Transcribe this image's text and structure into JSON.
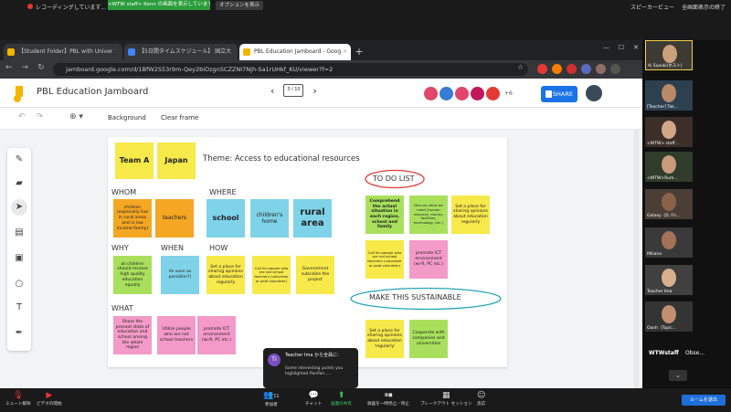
{
  "zoom_top": {
    "recording_label": "レコーディングしています...",
    "banner": "<WTW staff> Kenn の画面を表示しています",
    "options": "オプションを表示",
    "speaker_view": "スピーカービュー",
    "exit_fullscreen": "全画面表示の終了"
  },
  "browser": {
    "tabs": [
      {
        "label": "【Student Folder】PBL with Univer",
        "color": "#f4b400"
      },
      {
        "label": "【5日間タイムスケジュール】 国立大",
        "color": "#4285f4"
      },
      {
        "label": "PBL Education Jamboard - Goog",
        "color": "#f4b400"
      }
    ],
    "url": "jamboard.google.com/d/1BfW2S53r9m-Qey2biOzgnSCZZNI7Njh-Sa1rUHkf_KU/viewer?f=2"
  },
  "jamboard": {
    "title": "PBL Education Jamboard",
    "page_indicator": "3 / 10",
    "extra_collaborators": "+6",
    "share_label": "SHARE",
    "background_label": "Background",
    "clear_label": "Clear frame",
    "collab_colors": [
      "#e0476a",
      "#3a7bd5",
      "#e0476a",
      "#c2185b",
      "#e53935"
    ]
  },
  "board": {
    "team_a": "Team A",
    "japan": "Japan",
    "theme": "Theme: Access to educational resources",
    "whom_label": "WHOM",
    "where_label": "WHERE",
    "why_label": "WHY",
    "when_label": "WHEN",
    "how_label": "HOW",
    "what_label": "WHAT",
    "todo_label": "TO DO LIST",
    "sustain_label": "MAKE THIS SUSTAINABLE",
    "notes": {
      "whom1": "children (especially live in rural areas and in low income family)",
      "whom2": "teachers",
      "where1": "school",
      "where2": "children's home",
      "where3": "rural area",
      "why1": "all children should receive high quality education equally",
      "when1": "As soon as possible(?)",
      "how1": "Set a place for sharing opinions about education regularly",
      "how2": "Call for people who are not school teachers (volunteer or paid volunteer)",
      "how3": "Government subsidize the project",
      "what1": "Share the present state of education and school among the whole region",
      "what2": "Utilize people who are not school teachers",
      "what3": "promote ICT environment (wi-fi, PC etc.)",
      "todo1": "Comprehend the actual situation in each region, school and family",
      "todo2": "Discuss what we need (human resource, money, facilities, technology, etc.)",
      "todo3": "Set a place for sharing opinions about education regularly",
      "todo4": "Call for people who are not school teachers (volunteer or paid volunteer)",
      "todo5": "promote ICT environment (wi-fi, PC etc.)",
      "sus1": "Set a place for sharing opinions about education 'regularly'",
      "sus2": "Cooperate with companies and universities"
    }
  },
  "chat": {
    "avatar": "TI",
    "sender": "Teacher Ima から全員に:",
    "message": "Some interesting points you highlighted PanPan....."
  },
  "participants": [
    {
      "name": "Ai Suzuki(ホスト)"
    },
    {
      "name": "[Teacher] Tak..."
    },
    {
      "name": "<WTW> staff..."
    },
    {
      "name": "<WTW>Rum..."
    },
    {
      "name": "Galaxy（D. Fri..."
    },
    {
      "name": "Miliana"
    },
    {
      "name": "Teacher Ima"
    },
    {
      "name": "Oanh（Topic..."
    }
  ],
  "panel_footer": {
    "wtw": "WTWstaff",
    "obs": "Obse..."
  },
  "bottom_bar": {
    "mute": "ミュート解除",
    "video": "ビデオの開始",
    "participants": "参加者",
    "participant_count": "11",
    "chat": "チャット",
    "share": "画面の共有",
    "record": "録画を一時停止／停止",
    "breakout": "ブレークアウト セッション",
    "reactions": "反応",
    "leave": "ルームを退出"
  }
}
